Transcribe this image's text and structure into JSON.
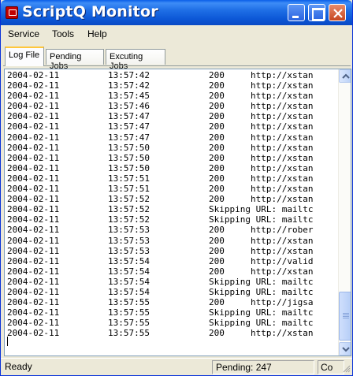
{
  "window": {
    "title": "ScriptQ Monitor",
    "controls": {
      "minimize": "minimize-icon",
      "maximize": "maximize-icon",
      "close": "close-icon"
    }
  },
  "menu": {
    "items": [
      "Service",
      "Tools",
      "Help"
    ]
  },
  "tabs": [
    {
      "label": "Log File",
      "active": true
    },
    {
      "label": "Pending Jobs",
      "active": false
    },
    {
      "label": "Excuting Jobs",
      "active": false
    }
  ],
  "log": {
    "lines": [
      {
        "date": "2004-02-11",
        "time": "13:57:42",
        "msg": "200     http://xstan"
      },
      {
        "date": "2004-02-11",
        "time": "13:57:42",
        "msg": "200     http://xstan"
      },
      {
        "date": "2004-02-11",
        "time": "13:57:45",
        "msg": "200     http://xstan"
      },
      {
        "date": "2004-02-11",
        "time": "13:57:46",
        "msg": "200     http://xstan"
      },
      {
        "date": "2004-02-11",
        "time": "13:57:47",
        "msg": "200     http://xstan"
      },
      {
        "date": "2004-02-11",
        "time": "13:57:47",
        "msg": "200     http://xstan"
      },
      {
        "date": "2004-02-11",
        "time": "13:57:47",
        "msg": "200     http://xstan"
      },
      {
        "date": "2004-02-11",
        "time": "13:57:50",
        "msg": "200     http://xstan"
      },
      {
        "date": "2004-02-11",
        "time": "13:57:50",
        "msg": "200     http://xstan"
      },
      {
        "date": "2004-02-11",
        "time": "13:57:50",
        "msg": "200     http://xstan"
      },
      {
        "date": "2004-02-11",
        "time": "13:57:51",
        "msg": "200     http://xstan"
      },
      {
        "date": "2004-02-11",
        "time": "13:57:51",
        "msg": "200     http://xstan"
      },
      {
        "date": "2004-02-11",
        "time": "13:57:52",
        "msg": "200     http://xstan"
      },
      {
        "date": "2004-02-11",
        "time": "13:57:52",
        "msg": "Skipping URL: mailtc"
      },
      {
        "date": "2004-02-11",
        "time": "13:57:52",
        "msg": "Skipping URL: mailtc"
      },
      {
        "date": "2004-02-11",
        "time": "13:57:53",
        "msg": "200     http://rober"
      },
      {
        "date": "2004-02-11",
        "time": "13:57:53",
        "msg": "200     http://xstan"
      },
      {
        "date": "2004-02-11",
        "time": "13:57:53",
        "msg": "200     http://xstan"
      },
      {
        "date": "2004-02-11",
        "time": "13:57:54",
        "msg": "200     http://valid"
      },
      {
        "date": "2004-02-11",
        "time": "13:57:54",
        "msg": "200     http://xstan"
      },
      {
        "date": "2004-02-11",
        "time": "13:57:54",
        "msg": "Skipping URL: mailtc"
      },
      {
        "date": "2004-02-11",
        "time": "13:57:54",
        "msg": "Skipping URL: mailtc"
      },
      {
        "date": "2004-02-11",
        "time": "13:57:55",
        "msg": "200     http://jigsa"
      },
      {
        "date": "2004-02-11",
        "time": "13:57:55",
        "msg": "Skipping URL: mailtc"
      },
      {
        "date": "2004-02-11",
        "time": "13:57:55",
        "msg": "Skipping URL: mailtc"
      },
      {
        "date": "2004-02-11",
        "time": "13:57:55",
        "msg": "200     http://xstan"
      }
    ]
  },
  "status": {
    "left": "Ready",
    "pending": "Pending: 247",
    "extra": "Co"
  },
  "colors": {
    "titlebar": "#0a49c4",
    "face": "#ece9d8",
    "active_tab_accent": "#ffc73c"
  }
}
